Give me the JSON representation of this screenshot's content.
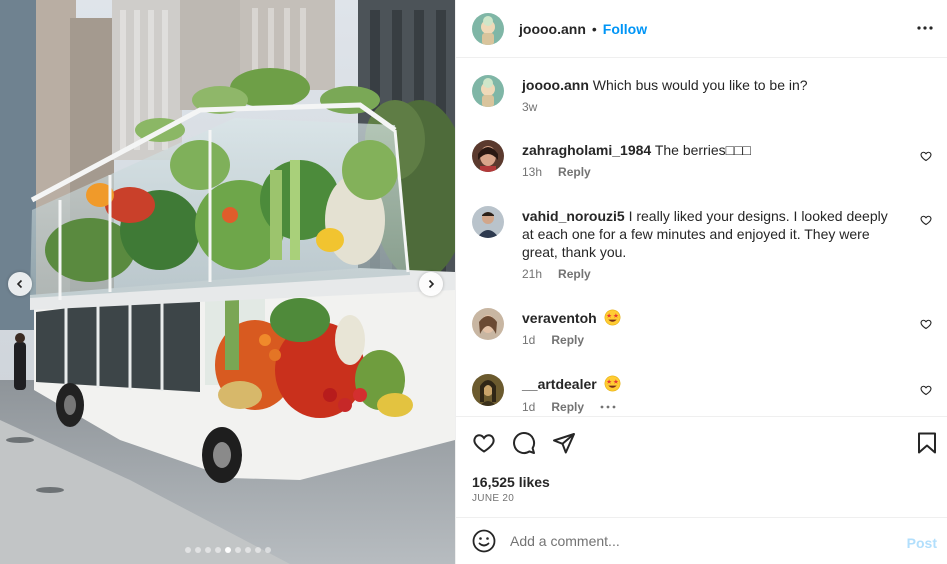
{
  "post": {
    "author": "joooo.ann",
    "separator": "•",
    "follow_label": "Follow",
    "more_icon": "more-horizontal-icon",
    "carousel": {
      "dot_count": 9,
      "active_index": 4
    }
  },
  "caption": {
    "username": "joooo.ann",
    "text": "Which bus would you like to be in?",
    "time": "3w"
  },
  "comments": [
    {
      "username": "zahragholami_1984",
      "text": "The berries□□□",
      "time": "13h",
      "reply": "Reply",
      "emoji": ""
    },
    {
      "username": "vahid_norouzi5",
      "text": "I really liked your designs. I looked deeply at each one for a few minutes and enjoyed it. They were great, thank you.",
      "time": "21h",
      "reply": "Reply",
      "emoji": ""
    },
    {
      "username": "veraventoh",
      "text": "",
      "time": "1d",
      "reply": "Reply",
      "emoji": "star-struck"
    },
    {
      "username": "__artdealer",
      "text": "",
      "time": "1d",
      "reply": "Reply",
      "emoji": "star-struck"
    }
  ],
  "actions": {
    "like_icon": "heart-icon",
    "comment_icon": "comment-icon",
    "share_icon": "send-icon",
    "save_icon": "bookmark-icon"
  },
  "likes": "16,525 likes",
  "date": "JUNE 20",
  "composer": {
    "placeholder": "Add a comment...",
    "post_label": "Post",
    "emoji_icon": "smiley-icon"
  },
  "colors": {
    "accent": "#0095f6",
    "post_disabled": "#b2dffc",
    "muted": "#737373",
    "divider": "#efefef"
  }
}
